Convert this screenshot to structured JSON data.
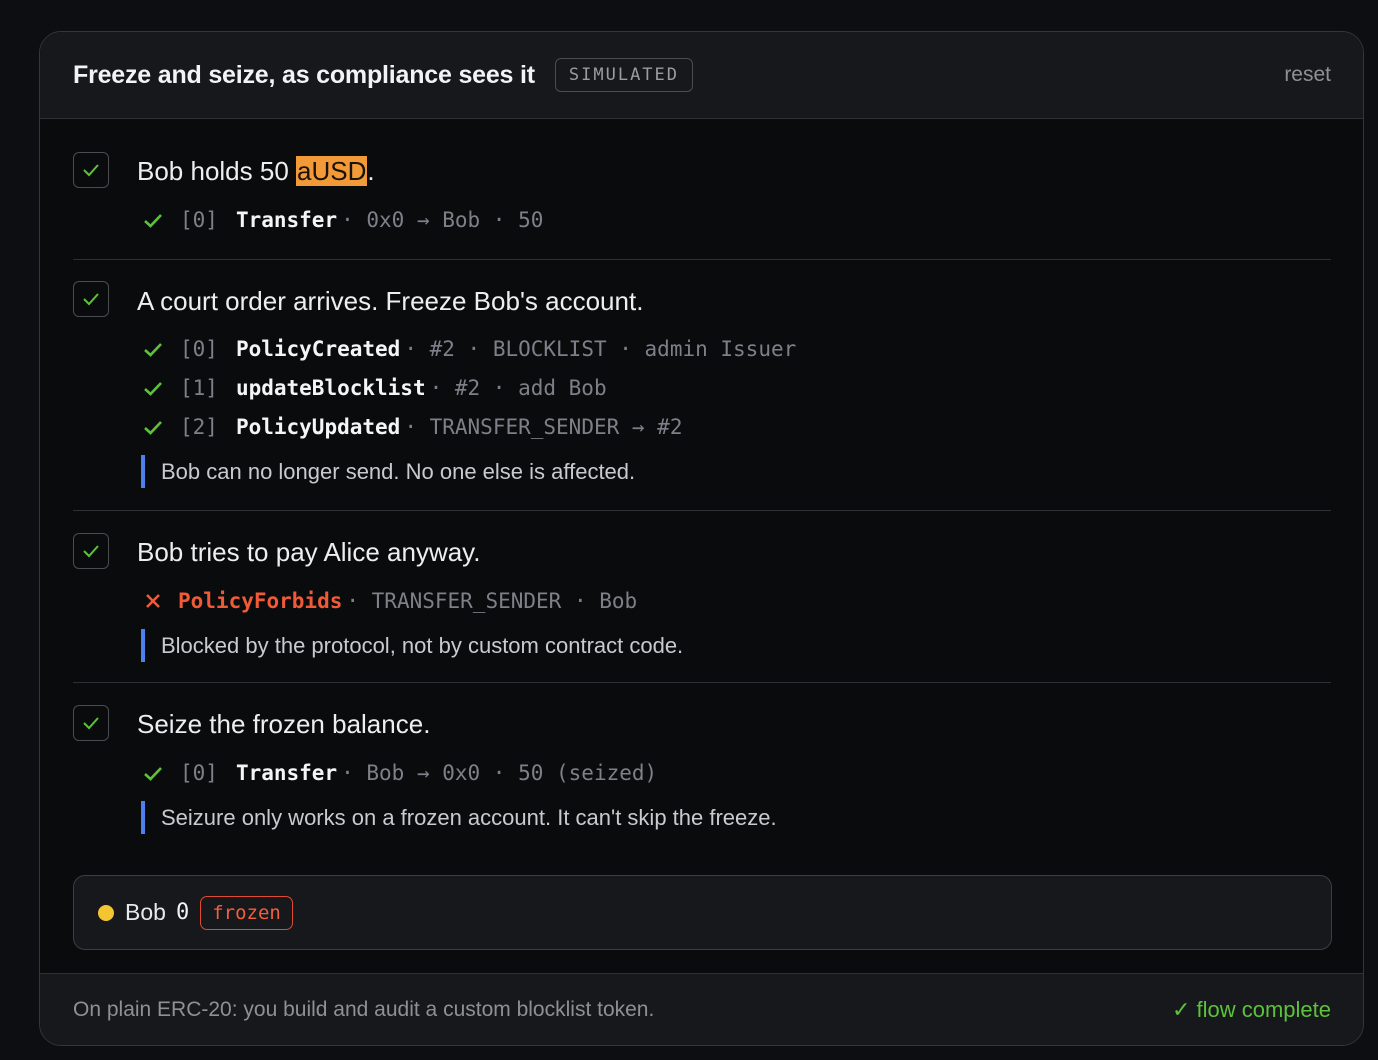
{
  "header": {
    "title": "Freeze and seize, as compliance sees it",
    "badge": "SIMULATED",
    "reset_label": "reset"
  },
  "steps": [
    {
      "title_before": "Bob holds 50 ",
      "title_highlight": "aUSD",
      "title_after": ".",
      "events": [
        {
          "status": "ok",
          "index": "[0]",
          "name": "Transfer",
          "args": "· 0x0 → Bob · 50"
        }
      ]
    },
    {
      "title": "A court order arrives. Freeze Bob's account.",
      "events": [
        {
          "status": "ok",
          "index": "[0]",
          "name": "PolicyCreated",
          "args": "· #2 · BLOCKLIST · admin Issuer"
        },
        {
          "status": "ok",
          "index": "[1]",
          "name": "updateBlocklist",
          "args": "· #2 · add Bob"
        },
        {
          "status": "ok",
          "index": "[2]",
          "name": "PolicyUpdated",
          "args": "· TRANSFER_SENDER → #2"
        }
      ],
      "note": "Bob can no longer send. No one else is affected."
    },
    {
      "title": "Bob tries to pay Alice anyway.",
      "events": [
        {
          "status": "error",
          "name": "PolicyForbids",
          "args": "· TRANSFER_SENDER · Bob"
        }
      ],
      "note": "Blocked by the protocol, not by custom contract code."
    },
    {
      "title": "Seize the frozen balance.",
      "events": [
        {
          "status": "ok",
          "index": "[0]",
          "name": "Transfer",
          "args": "· Bob → 0x0 · 50 (seized)"
        }
      ],
      "note": "Seizure only works on a frozen account. It can't skip the freeze."
    }
  ],
  "balance": {
    "holder": "Bob",
    "amount": "0",
    "status": "frozen"
  },
  "footer": {
    "note": "On plain ERC-20: you build and audit a custom blocklist token.",
    "status": "✓ flow complete"
  },
  "colors": {
    "ok": "#5cc23a",
    "error": "#f05a36",
    "note_bar": "#4b82ee",
    "highlight": "#f29a38",
    "dot": "#f2c531"
  },
  "icons": {
    "ok": "check-icon",
    "error": "cross-icon"
  }
}
